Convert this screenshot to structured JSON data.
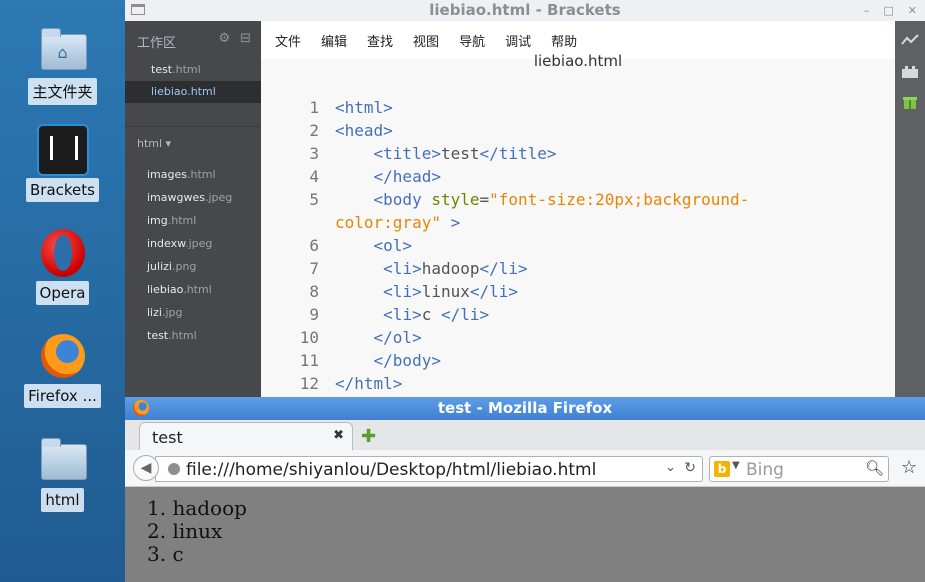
{
  "desktop": {
    "icons": [
      {
        "label": "主文件夹",
        "icon": "home-folder-icon"
      },
      {
        "label": "Brackets",
        "icon": "brackets-icon"
      },
      {
        "label": "Opera",
        "icon": "opera-icon"
      },
      {
        "label": "Firefox ...",
        "icon": "firefox-icon"
      },
      {
        "label": "html",
        "icon": "folder-icon"
      }
    ]
  },
  "brackets": {
    "window_title": "liebiao.html - Brackets",
    "window_buttons": [
      "–",
      "□",
      "✕"
    ],
    "sidebar": {
      "workspace_label": "工作区",
      "working_files": [
        {
          "name": "test",
          "ext": ".html"
        },
        {
          "name": "liebiao",
          "ext": ".html"
        }
      ],
      "project_label": "html ▾",
      "project_files": [
        {
          "name": "images",
          "ext": ".html"
        },
        {
          "name": "imawgwes",
          "ext": ".jpeg"
        },
        {
          "name": "img",
          "ext": ".html"
        },
        {
          "name": "indexw",
          "ext": ".jpeg"
        },
        {
          "name": "julizi",
          "ext": ".png"
        },
        {
          "name": "liebiao",
          "ext": ".html"
        },
        {
          "name": "lizi",
          "ext": ".jpg"
        },
        {
          "name": "test",
          "ext": ".html"
        }
      ]
    },
    "menu": [
      "文件",
      "编辑",
      "查找",
      "视图",
      "导航",
      "调试",
      "帮助"
    ],
    "doc_title": "liebiao.html",
    "line_numbers": [
      "1",
      "2",
      "3",
      "4",
      "5",
      "6",
      "7",
      "8",
      "9",
      "10",
      "11",
      "12"
    ],
    "code": {
      "l1_tag": "<html>",
      "l2_tag": "<head>",
      "l3_open": "<title>",
      "l3_text": "test",
      "l3_close": "</title>",
      "l4_tag": "</head>",
      "l5_tag": "<body",
      "l5_attr": "style",
      "l5_eq": "=",
      "l5_val_a": "\"font-size:20px;background-",
      "l5_val_b": "color:gray\"",
      "l5_end": ">",
      "l6_tag": "<ol>",
      "l7_open": "<li>",
      "l7_text": "hadoop",
      "l7_close": "</li>",
      "l8_open": "<li>",
      "l8_text": "linux",
      "l8_close": "</li>",
      "l9_open": "<li>",
      "l9_text": "c ",
      "l9_close": "</li>",
      "l10_tag": "</ol>",
      "l11_tag": "</body>",
      "l12_tag": "</html>"
    }
  },
  "firefox": {
    "window_title": "test - Mozilla Firefox",
    "tab_label": "test",
    "url": "file:///home/shiyanlou/Desktop/html/liebiao.html",
    "search_placeholder": "Bing",
    "search_engine_glyph": "b",
    "list_items": [
      "1. hadoop",
      "2. linux",
      "3. c"
    ]
  }
}
